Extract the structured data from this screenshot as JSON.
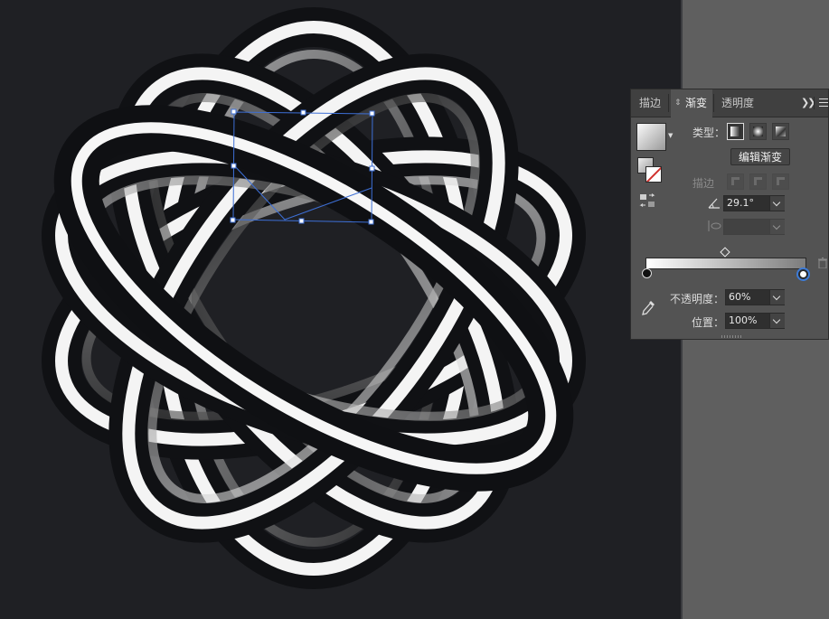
{
  "panel": {
    "tabs": [
      {
        "label": "描边"
      },
      {
        "label": "渐变"
      },
      {
        "label": "透明度"
      }
    ],
    "type_label": "类型：",
    "edit_gradient_label": "编辑渐变",
    "stroke_label": "描边",
    "angle": "29.1°",
    "opacity_label": "不透明度：",
    "opacity": "60%",
    "location_label": "位置：",
    "location": "100%"
  },
  "icons": {
    "collapse": "double-chevron-right-icon",
    "menu": "panel-menu-icon",
    "angle": "angle-icon",
    "aspect": "aspect-ratio-icon",
    "eyedropper": "eyedropper-icon",
    "trash": "trash-icon"
  },
  "colors": {
    "canvas_bg": "#1f2024",
    "panel_bg": "#535353",
    "selection": "#3d6fd6",
    "stroke_none_slash": "#d0312d"
  },
  "gradient": {
    "start_color": "#ffffff",
    "end_color": "#7c7c7c",
    "midpoint": 0.5
  }
}
